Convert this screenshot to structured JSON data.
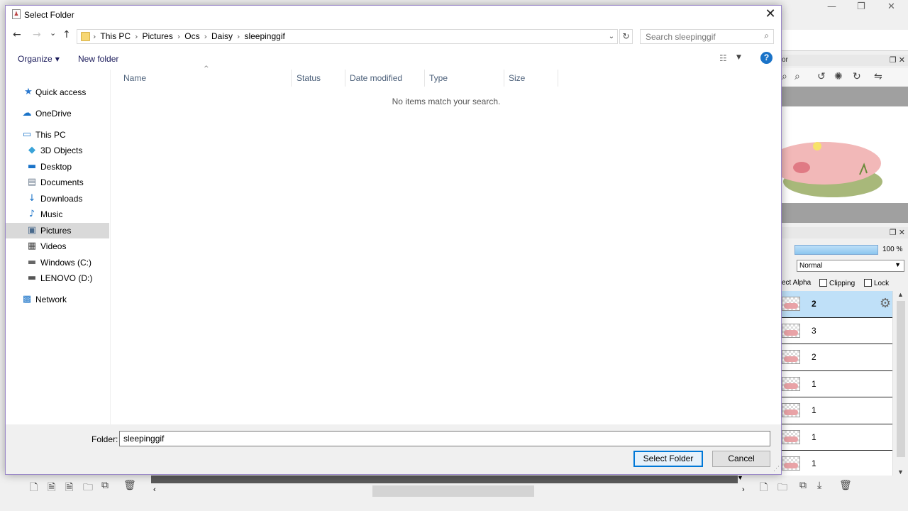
{
  "dialog": {
    "title": "Select Folder",
    "close_glyph": "✕"
  },
  "nav": {
    "back": "←",
    "forward": "→",
    "recent": "⌄",
    "up": "↑"
  },
  "address": {
    "crumbs": [
      "This PC",
      "Pictures",
      "Ocs",
      "Daisy",
      "sleepinggif"
    ],
    "separator": "›",
    "dropdown": "⌄",
    "refresh": "↻"
  },
  "search": {
    "placeholder": "Search sleepinggif",
    "icon": "⌕"
  },
  "commands": {
    "organize": "Organize",
    "new_folder": "New folder",
    "help": "?"
  },
  "sidebar": {
    "items": [
      {
        "label": "Quick access",
        "icon": "★",
        "color": "#2b79d0"
      },
      {
        "label": "OneDrive",
        "icon": "☁",
        "color": "#1a73c8"
      },
      {
        "label": "This PC",
        "icon": "▭",
        "color": "#1a73c8"
      },
      {
        "label": "3D Objects",
        "icon": "◆",
        "color": "#3aa3d8"
      },
      {
        "label": "Desktop",
        "icon": "▬",
        "color": "#1a73c8"
      },
      {
        "label": "Documents",
        "icon": "▤",
        "color": "#6a7a8c"
      },
      {
        "label": "Downloads",
        "icon": "↓",
        "color": "#1a73c8"
      },
      {
        "label": "Music",
        "icon": "♪",
        "color": "#1a73c8"
      },
      {
        "label": "Pictures",
        "icon": "▣",
        "color": "#4a6a8c"
      },
      {
        "label": "Videos",
        "icon": "▦",
        "color": "#444444"
      },
      {
        "label": "Windows (C:)",
        "icon": "▬",
        "color": "#666666"
      },
      {
        "label": "LENOVO (D:)",
        "icon": "▬",
        "color": "#555555"
      },
      {
        "label": "Network",
        "icon": "▩",
        "color": "#1a73c8"
      }
    ],
    "selected": "Pictures"
  },
  "columns": [
    "Name",
    "Status",
    "Date modified",
    "Type",
    "Size"
  ],
  "empty_message": "No items match your search.",
  "footer": {
    "folder_label": "Folder:",
    "folder_value": "sleepinggif",
    "select_button": "Select Folder",
    "cancel_button": "Cancel"
  },
  "background_app": {
    "panel_title_1": "or",
    "opacity": "100 %",
    "blend_mode": "Normal",
    "option_alpha": "ect Alpha",
    "option_clipping": "Clipping",
    "option_lock": "Lock",
    "layers": [
      {
        "name": "2",
        "selected": true
      },
      {
        "name": "3",
        "selected": false
      },
      {
        "name": "2",
        "selected": false
      },
      {
        "name": "1",
        "selected": false
      },
      {
        "name": "1",
        "selected": false
      },
      {
        "name": "1",
        "selected": false
      },
      {
        "name": "1",
        "selected": false
      }
    ]
  }
}
